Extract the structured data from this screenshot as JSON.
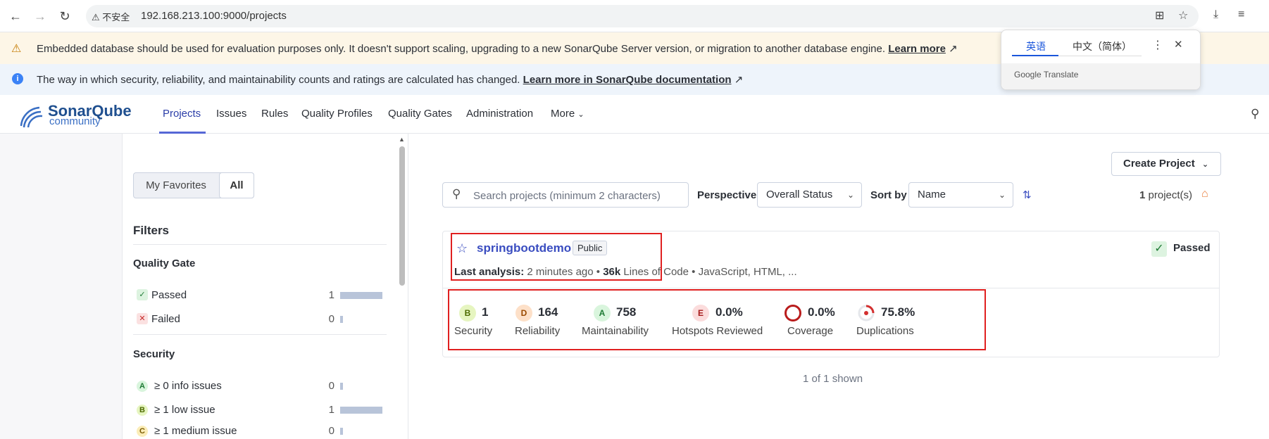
{
  "browser": {
    "url_warning": "不安全",
    "url": "192.168.213.100:9000/projects"
  },
  "translate_popup": {
    "lang_source": "英语",
    "lang_target": "中文（简体）",
    "footer": "Google Translate"
  },
  "banners": {
    "warning_text": "Embedded database should be used for evaluation purposes only. It doesn't support scaling, upgrading to a new SonarQube Server version, or migration to another database engine.",
    "warning_link": "Learn more",
    "info_text": "The way in which security, reliability, and maintainability counts and ratings are calculated has changed.",
    "info_link": "Learn more in SonarQube documentation"
  },
  "header": {
    "logo_main": "SonarQube",
    "logo_sub": "community",
    "menu": [
      "Projects",
      "Issues",
      "Rules",
      "Quality Profiles",
      "Quality Gates",
      "Administration",
      "More"
    ]
  },
  "sidebar": {
    "favorites_label": "My Favorites",
    "all_label": "All",
    "filters_title": "Filters",
    "quality_gate": {
      "title": "Quality Gate",
      "items": [
        {
          "label": "Passed",
          "count": "1",
          "share": 1.0
        },
        {
          "label": "Failed",
          "count": "0",
          "share": 0.0
        }
      ]
    },
    "security": {
      "title": "Security",
      "items": [
        {
          "grade": "A",
          "label": "≥ 0 info issues",
          "count": "0",
          "share": 0.0
        },
        {
          "grade": "B",
          "label": "≥ 1 low issue",
          "count": "1",
          "share": 1.0
        },
        {
          "grade": "C",
          "label": "≥ 1 medium issue",
          "count": "0",
          "share": 0.0
        }
      ]
    }
  },
  "toolbar": {
    "create_project": "Create Project",
    "search_placeholder": "Search projects (minimum 2 characters)",
    "perspective_label": "Perspective",
    "perspective_value": "Overall Status",
    "sort_label": "Sort by",
    "sort_value": "Name",
    "count_number": "1",
    "count_suffix": "project(s)"
  },
  "project": {
    "name": "springbootdemo",
    "visibility": "Public",
    "last_analysis_label": "Last analysis:",
    "last_analysis_value": "2 minutes ago",
    "loc_value": "36k",
    "loc_label": "Lines of Code",
    "languages": "JavaScript, HTML, ...",
    "quality_gate": "Passed",
    "metrics": [
      {
        "grade": "B",
        "value": "1",
        "label": "Security"
      },
      {
        "grade": "D",
        "value": "164",
        "label": "Reliability"
      },
      {
        "grade": "A",
        "value": "758",
        "label": "Maintainability"
      },
      {
        "grade": "E",
        "value": "0.0%",
        "label": "Hotspots Reviewed"
      },
      {
        "grade": "",
        "value": "0.0%",
        "label": "Coverage"
      },
      {
        "grade": "",
        "value": "75.8%",
        "label": "Duplications"
      }
    ]
  },
  "footer": {
    "shown": "1 of 1 shown"
  },
  "colors": {
    "accent": "#3a4dc0",
    "warning_bg": "#fdf6e7",
    "info_bg": "#eef4fb",
    "highlight": "#e02020"
  }
}
